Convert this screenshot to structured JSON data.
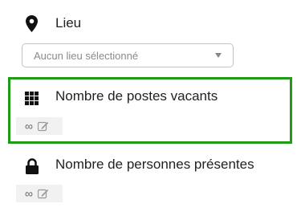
{
  "fields": [
    {
      "label": "Lieu",
      "icon": "location-pin-icon"
    },
    {
      "label": "Nombre de postes vacants",
      "icon": "grid-icon",
      "value": "∞"
    },
    {
      "label": "Nombre de personnes présentes",
      "icon": "lock-icon",
      "value": "∞"
    }
  ],
  "lieu_select": {
    "selected": "Aucun lieu sélectionné"
  },
  "highlight_color": "#1f9b16"
}
